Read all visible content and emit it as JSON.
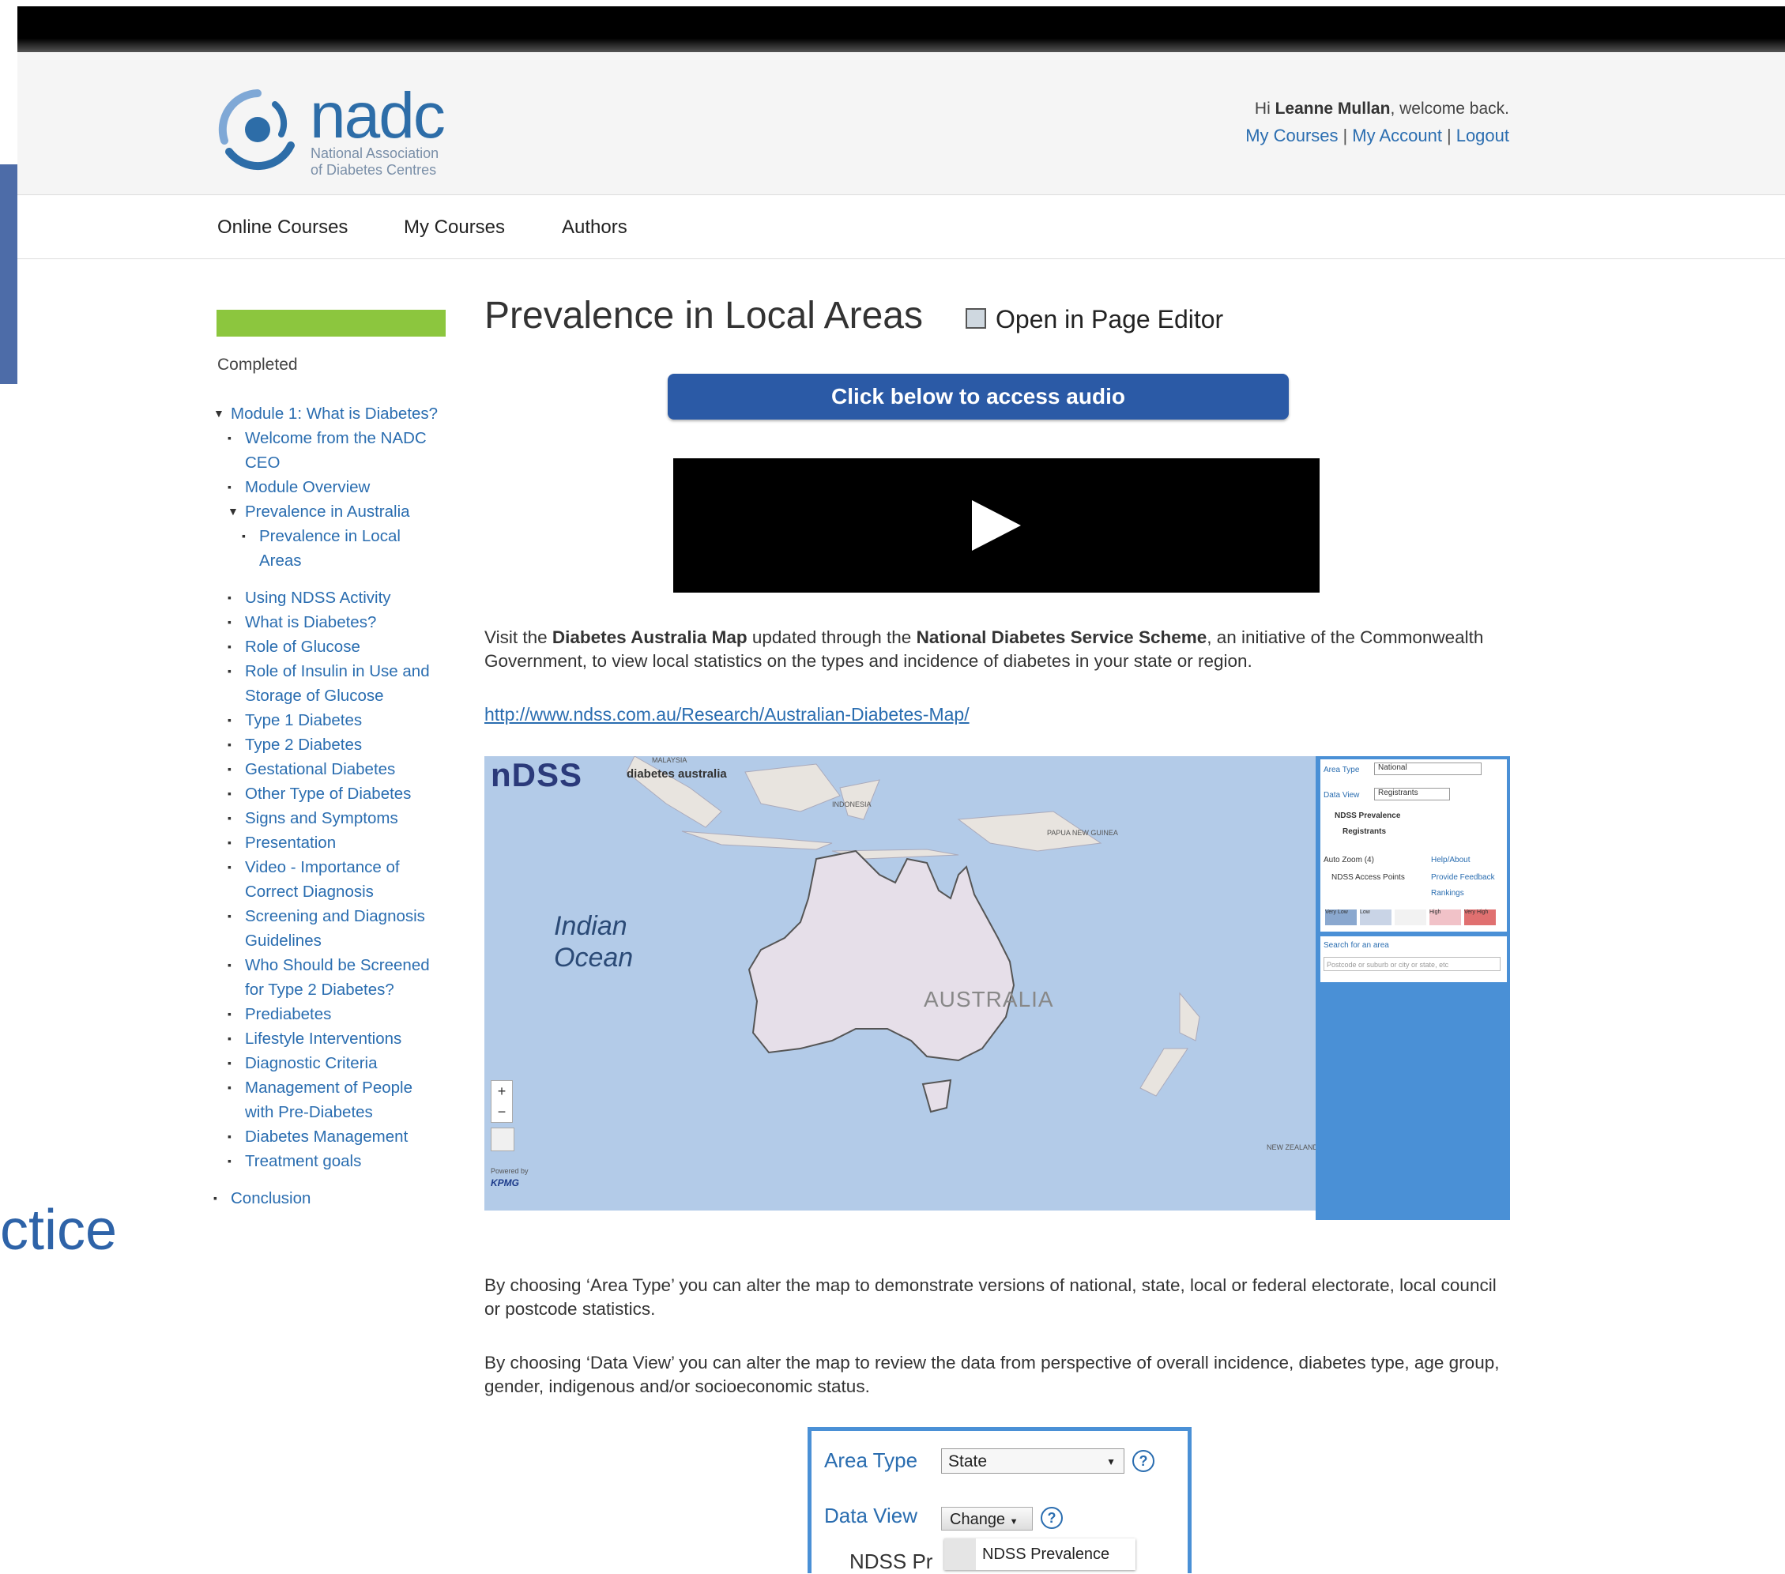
{
  "header": {
    "logo_word": "nadc",
    "logo_sub_1": "National Association",
    "logo_sub_2": "of Diabetes Centres",
    "greeting_prefix": "Hi ",
    "user_name": "Leanne Mullan",
    "greeting_suffix": ", welcome back.",
    "links": [
      "My Courses",
      "My Account",
      "Logout"
    ]
  },
  "nav": [
    "Online Courses",
    "My Courses",
    "Authors"
  ],
  "sidebar": {
    "progress_label": "Completed",
    "progress_value": 1.0,
    "tree": [
      {
        "label": "Module 1: What is Diabetes?",
        "level": 0,
        "marker": "▼"
      },
      {
        "label": "Welcome from the NADC",
        "level": 1,
        "marker": "▪"
      },
      {
        "label": "CEO",
        "level": 1,
        "marker": ""
      },
      {
        "label": "Module Overview",
        "level": 1,
        "marker": "▪"
      },
      {
        "label": "Prevalence in Australia",
        "level": 1,
        "marker": "▼"
      },
      {
        "label": "Prevalence in Local",
        "level": 2,
        "marker": "▪"
      },
      {
        "label": "Areas",
        "level": 2,
        "marker": ""
      },
      {
        "label": "Using NDSS Activity",
        "level": 1,
        "marker": "▪",
        "gap": true
      },
      {
        "label": "What is Diabetes?",
        "level": 1,
        "marker": "▪"
      },
      {
        "label": "Role of Glucose",
        "level": 1,
        "marker": "▪"
      },
      {
        "label": "Role of Insulin in Use and",
        "level": 1,
        "marker": "▪"
      },
      {
        "label": "Storage of Glucose",
        "level": 1,
        "marker": ""
      },
      {
        "label": "Type 1 Diabetes",
        "level": 1,
        "marker": "▪"
      },
      {
        "label": "Type 2 Diabetes",
        "level": 1,
        "marker": "▪"
      },
      {
        "label": "Gestational Diabetes",
        "level": 1,
        "marker": "▪"
      },
      {
        "label": "Other Type of Diabetes",
        "level": 1,
        "marker": "▪"
      },
      {
        "label": "Signs and Symptoms",
        "level": 1,
        "marker": "▪"
      },
      {
        "label": "Presentation",
        "level": 1,
        "marker": "▪"
      },
      {
        "label": "Video - Importance of",
        "level": 1,
        "marker": "▪"
      },
      {
        "label": "Correct Diagnosis",
        "level": 1,
        "marker": ""
      },
      {
        "label": "Screening and Diagnosis",
        "level": 1,
        "marker": "▪"
      },
      {
        "label": "Guidelines",
        "level": 1,
        "marker": ""
      },
      {
        "label": "Who Should be Screened",
        "level": 1,
        "marker": "▪"
      },
      {
        "label": "for Type 2 Diabetes?",
        "level": 1,
        "marker": ""
      },
      {
        "label": "Prediabetes",
        "level": 1,
        "marker": "▪"
      },
      {
        "label": "Lifestyle Interventions",
        "level": 1,
        "marker": "▪"
      },
      {
        "label": "Diagnostic Criteria",
        "level": 1,
        "marker": "▪"
      },
      {
        "label": "Management of People",
        "level": 1,
        "marker": "▪"
      },
      {
        "label": "with Pre-Diabetes",
        "level": 1,
        "marker": ""
      },
      {
        "label": "Diabetes Management",
        "level": 1,
        "marker": "▪"
      },
      {
        "label": "Treatment goals",
        "level": 1,
        "marker": "▪"
      },
      {
        "label": "Conclusion",
        "level": 0,
        "marker": "▪",
        "gap": true
      }
    ]
  },
  "main": {
    "title": "Prevalence in Local Areas",
    "editor_label": "Open in Page Editor",
    "audio_button": "Click below to access audio",
    "intro_1": "Visit the ",
    "intro_bold_1": "Diabetes Australia Map",
    "intro_2": " updated through the ",
    "intro_bold_2": "National Diabetes Service Scheme",
    "intro_3": ", an initiative of the Commonwealth Government, to view local statistics on the types and incidence of diabetes in your state or region.",
    "link": "http://www.ndss.com.au/Research/Australian-Diabetes-Map/",
    "para_area_type": "By choosing ‘Area Type’ you can alter the map to demonstrate versions of national, state, local or federal electorate, local council or postcode statistics.",
    "para_data_view": "By choosing ‘Data View’ you can alter the map to review the data from perspective of overall incidence, diabetes type, age group, gender, indigenous and/or socioeconomic status."
  },
  "map": {
    "logo": "nDSS",
    "logo_partner": "diabetes australia",
    "ocean_1": "Indian",
    "ocean_2": "Ocean",
    "country": "AUSTRALIA",
    "labels": [
      "MALAYSIA",
      "INDONESIA",
      "PAPUA NEW GUINEA",
      "NEW ZEALAND"
    ],
    "panel": {
      "area_type_label": "Area Type",
      "area_type_value": "National",
      "data_view_label": "Data View",
      "data_view_value": "Registrants",
      "heading": "NDSS Prevalence",
      "subheading": "Registrants",
      "auto_zoom": "Auto Zoom (4)",
      "access_points": "NDSS Access Points",
      "links": [
        "Help/About",
        "Provide Feedback",
        "Rankings"
      ],
      "legend": [
        "Very Low",
        "Low",
        "",
        "High",
        "Very High"
      ],
      "search_label": "Search for an area",
      "search_placeholder": "Postcode or suburb or city or state, etc"
    },
    "powered_by": "Powered by",
    "kpmg": "KPMG"
  },
  "dataview_widget": {
    "area_type_label": "Area Type",
    "area_type_value": "State",
    "data_view_label": "Data View",
    "change_button": "Change",
    "truncated_text": "NDSS Pr",
    "dropdown_item": "NDSS Prevalence"
  },
  "background_text": "ctice",
  "colors": {
    "link": "#2a6db0",
    "progress": "#8cc63e",
    "audio_button": "#2b5aa6",
    "map_water": "#b3cbe8",
    "map_land": "#e6dfe9",
    "map_panel": "#4a90d6"
  }
}
